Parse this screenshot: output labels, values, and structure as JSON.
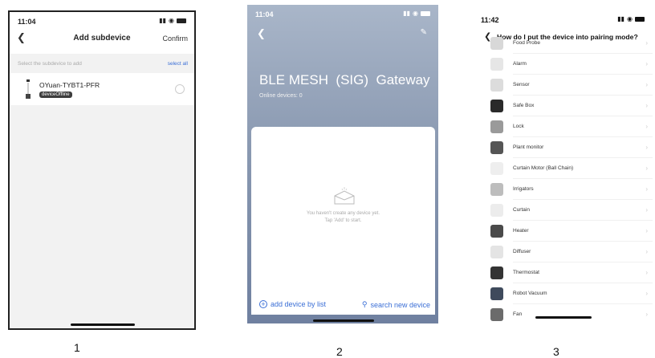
{
  "screens": [
    {
      "caption": "1",
      "status_time": "11:04",
      "title": "Add subdevice",
      "confirm_label": "Confirm",
      "select_hint": "Select the subdevice to add",
      "select_all_label": "select all",
      "device": {
        "name": "OYuan-TYBT1-PFR",
        "status": "deviceOffline"
      }
    },
    {
      "caption": "2",
      "status_time": "11:04",
      "gateway_title": "BLE MESH  (SIG)  Gateway",
      "online_devices": "Online devices: 0",
      "empty_line1": "You haven't create any device yet.",
      "empty_line2": "Tap 'Add' to start.",
      "add_by_list_label": "add device by list",
      "search_new_label": "search new device"
    },
    {
      "caption": "3",
      "status_time": "11:42",
      "title": "How do I put the device into pairing mode?",
      "items": [
        {
          "label": "Food Probe",
          "icon": "probe-icon",
          "color": "#d8d8d8"
        },
        {
          "label": "Alarm",
          "icon": "alarm-icon",
          "color": "#e6e6e6"
        },
        {
          "label": "Sensor",
          "icon": "sensor-icon",
          "color": "#dcdcdc"
        },
        {
          "label": "Safe Box",
          "icon": "safe-box-icon",
          "color": "#2a2a2a"
        },
        {
          "label": "Lock",
          "icon": "lock-icon",
          "color": "#9a9a9a"
        },
        {
          "label": "Plant monitor",
          "icon": "plant-monitor-icon",
          "color": "#555555"
        },
        {
          "label": "Curtain Motor (Ball Chain)",
          "icon": "curtain-motor-icon",
          "color": "#eeeeee"
        },
        {
          "label": "Irrigators",
          "icon": "irrigator-icon",
          "color": "#bdbdbd"
        },
        {
          "label": "Curtain",
          "icon": "curtain-icon",
          "color": "#ececec"
        },
        {
          "label": "Heater",
          "icon": "heater-icon",
          "color": "#4a4a4a"
        },
        {
          "label": "Diffuser",
          "icon": "diffuser-icon",
          "color": "#e4e4e4"
        },
        {
          "label": "Thermostat",
          "icon": "thermostat-icon",
          "color": "#333333"
        },
        {
          "label": "Robot Vacuum",
          "icon": "robot-vacuum-icon",
          "color": "#3f4a5c"
        },
        {
          "label": "Fan",
          "icon": "fan-icon",
          "color": "#6b6b6b"
        }
      ]
    }
  ]
}
